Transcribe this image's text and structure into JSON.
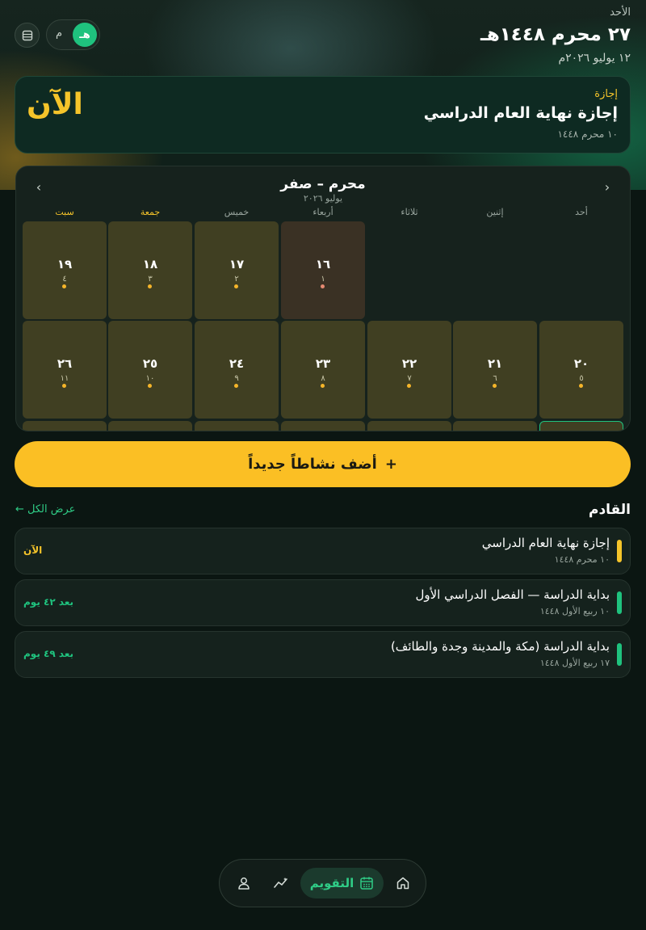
{
  "header": {
    "weekday": "الأحد",
    "hijri_date": "٢٧ محرم ١٤٤٨هـ",
    "gregorian_date": "١٢ يوليو ٢٠٢٦م",
    "toggle": {
      "hijri": "هـ",
      "gregorian": "م",
      "selected": "hijri"
    },
    "menu_icon": "list-icon"
  },
  "current_event": {
    "type": "إجازة",
    "title": "إجازة نهاية العام الدراسي",
    "date": "١٠ محرم ١٤٤٨",
    "status": "الآن"
  },
  "calendar": {
    "title": "محرم – صفر",
    "subtitle": "يوليو ٢٠٢٦",
    "weekdays": [
      "أحد",
      "إثنين",
      "ثلاثاء",
      "أربعاء",
      "خميس",
      "جمعة",
      "سبت"
    ],
    "weekend_color": "#f5c42a",
    "row1": [
      {
        "day": "١٦",
        "hijri": "١",
        "today": true
      },
      {
        "day": "١٧",
        "hijri": "٢"
      },
      {
        "day": "١٨",
        "hijri": "٣"
      },
      {
        "day": "١٩",
        "hijri": "٤"
      }
    ],
    "row2": [
      {
        "day": "٢٠",
        "hijri": "٥"
      },
      {
        "day": "٢١",
        "hijri": "٦"
      },
      {
        "day": "٢٢",
        "hijri": "٧"
      },
      {
        "day": "٢٣",
        "hijri": "٨"
      },
      {
        "day": "٢٤",
        "hijri": "٩"
      },
      {
        "day": "٢٥",
        "hijri": "١٠"
      },
      {
        "day": "٢٦",
        "hijri": "١١"
      }
    ]
  },
  "add_button": {
    "label": "أضف نشاطاً جديداً",
    "icon": "+"
  },
  "upcoming": {
    "title": "القادم",
    "see_all": "عرض الكل ←",
    "items": [
      {
        "title": "إجازة نهاية العام الدراسي",
        "date": "١٠ محرم ١٤٤٨",
        "when": "الآن",
        "color": "#f5c42a"
      },
      {
        "title": "بداية الدراسة — الفصل الدراسي الأول",
        "date": "١٠ ربيع الأول ١٤٤٨",
        "when": "بعد ٤٢ يوم",
        "color": "#1fc27e"
      },
      {
        "title": "بداية الدراسة (مكة والمدينة وجدة والطائف)",
        "date": "١٧ ربيع الأول ١٤٤٨",
        "when": "بعد ٤٩ يوم",
        "color": "#1fc27e"
      }
    ]
  },
  "bottom_nav": {
    "items": [
      {
        "icon": "home-icon"
      },
      {
        "icon": "calendar-icon",
        "label": "التقويم",
        "active": true
      },
      {
        "icon": "trend-icon"
      },
      {
        "icon": "profile-icon"
      }
    ]
  },
  "colors": {
    "accent_green": "#1fc27e",
    "accent_gold": "#fbbf24",
    "background": "#0b1612"
  }
}
